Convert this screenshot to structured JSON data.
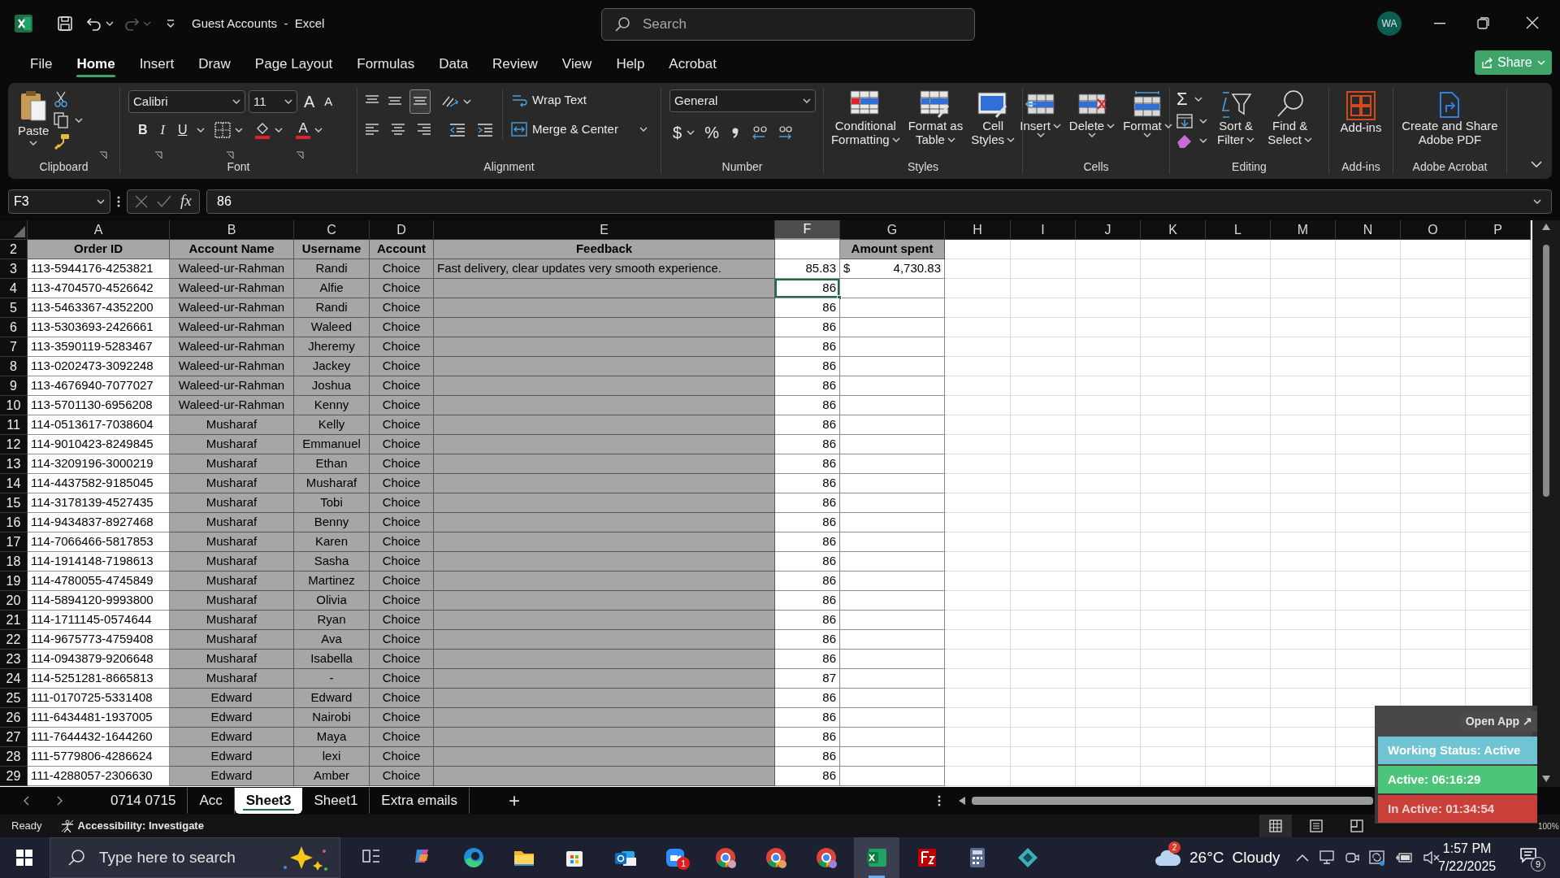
{
  "window": {
    "title": "Guest Accounts  -  Excel",
    "search_placeholder": "Search",
    "avatar": "WA"
  },
  "menu_tabs": [
    {
      "label": "File",
      "selected": false
    },
    {
      "label": "Home",
      "selected": true
    },
    {
      "label": "Insert",
      "selected": false
    },
    {
      "label": "Draw",
      "selected": false
    },
    {
      "label": "Page Layout",
      "selected": false
    },
    {
      "label": "Formulas",
      "selected": false
    },
    {
      "label": "Data",
      "selected": false
    },
    {
      "label": "Review",
      "selected": false
    },
    {
      "label": "View",
      "selected": false
    },
    {
      "label": "Help",
      "selected": false
    },
    {
      "label": "Acrobat",
      "selected": false
    }
  ],
  "share_button": "Share",
  "ribbon": {
    "clipboard": {
      "paste": "Paste",
      "label": "Clipboard"
    },
    "font": {
      "font_name": "Calibri",
      "font_size": "11",
      "grow": "A",
      "shrink": "A",
      "bold": "B",
      "italic": "I",
      "underline": "U",
      "font_color": "A",
      "label": "Font"
    },
    "alignment": {
      "wrap_text": "Wrap Text",
      "merge_center": "Merge & Center",
      "label": "Alignment"
    },
    "number": {
      "format": "General",
      "currency": "$",
      "percent": "%",
      "label": "Number"
    },
    "styles": {
      "buttons": [
        [
          "Conditional",
          "Formatting"
        ],
        [
          "Format as",
          "Table"
        ],
        [
          "Cell",
          "Styles"
        ]
      ],
      "label": "Styles"
    },
    "cells": {
      "buttons": [
        "Insert",
        "Delete",
        "Format"
      ],
      "label": "Cells"
    },
    "editing": {
      "sum": "Σ",
      "buttons": [
        [
          "Sort &",
          "Filter"
        ],
        [
          "Find &",
          "Select"
        ]
      ],
      "label": "Editing"
    },
    "addins": {
      "button": "Add-ins",
      "label": "Add-ins"
    },
    "acrobat": {
      "button": [
        "Create and Share",
        "Adobe PDF"
      ],
      "label": "Adobe Acrobat"
    }
  },
  "formula_bar": {
    "name_box": "F3",
    "fx": "fx",
    "value": "86"
  },
  "sheet": {
    "columns": [
      {
        "letter": "A",
        "selected": false
      },
      {
        "letter": "B",
        "selected": false
      },
      {
        "letter": "C",
        "selected": false
      },
      {
        "letter": "D",
        "selected": false
      },
      {
        "letter": "E",
        "selected": false
      },
      {
        "letter": "F",
        "selected": true
      },
      {
        "letter": "G",
        "selected": false
      },
      {
        "letter": "H",
        "selected": false
      },
      {
        "letter": "I",
        "selected": false
      },
      {
        "letter": "J",
        "selected": false
      },
      {
        "letter": "K",
        "selected": false
      },
      {
        "letter": "L",
        "selected": false
      },
      {
        "letter": "M",
        "selected": false
      },
      {
        "letter": "N",
        "selected": false
      },
      {
        "letter": "O",
        "selected": false
      },
      {
        "letter": "P",
        "selected": false
      }
    ],
    "rows": [
      {
        "number": "2",
        "kind": "header",
        "order_id": "Order ID",
        "account_name": "Account Name",
        "username": "Username",
        "account": "Account",
        "feedback": "Feedback",
        "amount": "Amount spent",
        "selected": false
      },
      {
        "number": "3",
        "kind": "data",
        "order_id": "113-5944176-4253821",
        "account_name": "Waleed-ur-Rahman",
        "username": "Randi",
        "account": "Choice",
        "feedback": "Fast delivery, clear updates very smooth experience.",
        "score": "85.83",
        "currency": "$",
        "amount": "4,730.83",
        "selected": false
      },
      {
        "number": "4",
        "kind": "data",
        "order_id": "113-4704570-4526642",
        "account_name": "Waleed-ur-Rahman",
        "username": "Alfie",
        "account": "Choice",
        "score": "86",
        "selected": true
      },
      {
        "number": "5",
        "kind": "data",
        "order_id": "113-5463367-4352200",
        "account_name": "Waleed-ur-Rahman",
        "username": "Randi",
        "account": "Choice",
        "score": "86",
        "selected": false
      },
      {
        "number": "6",
        "kind": "data",
        "order_id": "113-5303693-2426661",
        "account_name": "Waleed-ur-Rahman",
        "username": "Waleed",
        "account": "Choice",
        "score": "86",
        "selected": false
      },
      {
        "number": "7",
        "kind": "data",
        "order_id": "113-3590119-5283467",
        "account_name": "Waleed-ur-Rahman",
        "username": "Jheremy",
        "account": "Choice",
        "score": "86",
        "selected": false
      },
      {
        "number": "8",
        "kind": "data",
        "order_id": "113-0202473-3092248",
        "account_name": "Waleed-ur-Rahman",
        "username": "Jackey",
        "account": "Choice",
        "score": "86",
        "selected": false
      },
      {
        "number": "9",
        "kind": "data",
        "order_id": "113-4676940-7077027",
        "account_name": "Waleed-ur-Rahman",
        "username": "Joshua",
        "account": "Choice",
        "score": "86",
        "selected": false
      },
      {
        "number": "10",
        "kind": "data",
        "order_id": "113-5701130-6956208",
        "account_name": "Waleed-ur-Rahman",
        "username": "Kenny",
        "account": "Choice",
        "score": "86",
        "selected": false
      },
      {
        "number": "11",
        "kind": "data",
        "order_id": "114-0513617-7038604",
        "account_name": "Musharaf",
        "username": "Kelly",
        "account": "Choice",
        "score": "86",
        "selected": false
      },
      {
        "number": "12",
        "kind": "data",
        "order_id": "114-9010423-8249845",
        "account_name": "Musharaf",
        "username": "Emmanuel",
        "account": "Choice",
        "score": "86",
        "selected": false
      },
      {
        "number": "13",
        "kind": "data",
        "order_id": "114-3209196-3000219",
        "account_name": "Musharaf",
        "username": "Ethan",
        "account": "Choice",
        "score": "86",
        "selected": false
      },
      {
        "number": "14",
        "kind": "data",
        "order_id": "114-4437582-9185045",
        "account_name": "Musharaf",
        "username": "Musharaf",
        "account": "Choice",
        "score": "86",
        "selected": false
      },
      {
        "number": "15",
        "kind": "data",
        "order_id": "114-3178139-4527435",
        "account_name": "Musharaf",
        "username": "Tobi",
        "account": "Choice",
        "score": "86",
        "selected": false
      },
      {
        "number": "16",
        "kind": "data",
        "order_id": "114-9434837-8927468",
        "account_name": "Musharaf",
        "username": "Benny",
        "account": "Choice",
        "score": "86",
        "selected": false
      },
      {
        "number": "17",
        "kind": "data",
        "order_id": "114-7066466-5817853",
        "account_name": "Musharaf",
        "username": "Karen",
        "account": "Choice",
        "score": "86",
        "selected": false
      },
      {
        "number": "18",
        "kind": "data",
        "order_id": "114-1914148-7198613",
        "account_name": "Musharaf",
        "username": "Sasha",
        "account": "Choice",
        "score": "86",
        "selected": false
      },
      {
        "number": "19",
        "kind": "data",
        "order_id": "114-4780055-4745849",
        "account_name": "Musharaf",
        "username": "Martinez",
        "account": "Choice",
        "score": "86",
        "selected": false
      },
      {
        "number": "20",
        "kind": "data",
        "order_id": "114-5894120-9993800",
        "account_name": "Musharaf",
        "username": "Olivia",
        "account": "Choice",
        "score": "86",
        "selected": false
      },
      {
        "number": "21",
        "kind": "data",
        "order_id": "114-1711145-0574644",
        "account_name": "Musharaf",
        "username": "Ryan",
        "account": "Choice",
        "score": "86",
        "selected": false
      },
      {
        "number": "22",
        "kind": "data",
        "order_id": "114-9675773-4759408",
        "account_name": "Musharaf",
        "username": "Ava",
        "account": "Choice",
        "score": "86",
        "selected": false
      },
      {
        "number": "23",
        "kind": "data",
        "order_id": "114-0943879-9206648",
        "account_name": "Musharaf",
        "username": "Isabella",
        "account": "Choice",
        "score": "86",
        "selected": false
      },
      {
        "number": "24",
        "kind": "data",
        "order_id": "114-5251281-8665813",
        "account_name": "Musharaf",
        "username": "-",
        "account": "Choice",
        "score": "87",
        "selected": false
      },
      {
        "number": "25",
        "kind": "data",
        "order_id": "111-0170725-5331408",
        "account_name": "Edward",
        "username": "Edward",
        "account": "Choice",
        "score": "86",
        "selected": false
      },
      {
        "number": "26",
        "kind": "data",
        "order_id": "111-6434481-1937005",
        "account_name": "Edward",
        "username": "Nairobi",
        "account": "Choice",
        "score": "86",
        "selected": false
      },
      {
        "number": "27",
        "kind": "data",
        "order_id": "111-7644432-1644260",
        "account_name": "Edward",
        "username": "Maya",
        "account": "Choice",
        "score": "86",
        "selected": false
      },
      {
        "number": "28",
        "kind": "data",
        "order_id": "111-5779806-4286624",
        "account_name": "Edward",
        "username": "lexi",
        "account": "Choice",
        "score": "86",
        "selected": false
      },
      {
        "number": "29",
        "kind": "data",
        "order_id": "111-4288057-2306630",
        "account_name": "Edward",
        "username": "Amber",
        "account": "Choice",
        "score": "86",
        "selected": false
      }
    ]
  },
  "sheet_tabs": [
    {
      "label": "0714 0715",
      "selected": false
    },
    {
      "label": "Acc",
      "selected": false
    },
    {
      "label": "Sheet3",
      "selected": true
    },
    {
      "label": "Sheet1",
      "selected": false
    },
    {
      "label": "Extra emails",
      "selected": false
    }
  ],
  "add_sheet": "+",
  "status_bar": {
    "ready": "Ready",
    "accessibility": "Accessibility: Investigate",
    "zoom": "100%"
  },
  "tracker_widget": {
    "open_app": "Open App ↗",
    "working_status": "Working Status: Active",
    "active": "Active: 06:16:29",
    "inactive": "In Active: 01:34:54"
  },
  "taskbar": {
    "search_placeholder": "Type here to search",
    "apps": [
      {
        "selected": false
      },
      {
        "selected": false
      },
      {
        "selected": false
      },
      {
        "selected": false
      },
      {
        "selected": false
      },
      {
        "selected": false
      },
      {
        "selected": false,
        "badge": "1"
      },
      {
        "selected": false
      },
      {
        "selected": false
      },
      {
        "selected": false
      },
      {
        "selected": true
      },
      {
        "selected": false
      },
      {
        "selected": false
      },
      {
        "selected": false
      }
    ],
    "weather": {
      "badge": "2",
      "temperature": "26°C",
      "condition": "Cloudy"
    },
    "time": "1:57 PM",
    "date": "7/22/2025",
    "notifications": "9"
  }
}
